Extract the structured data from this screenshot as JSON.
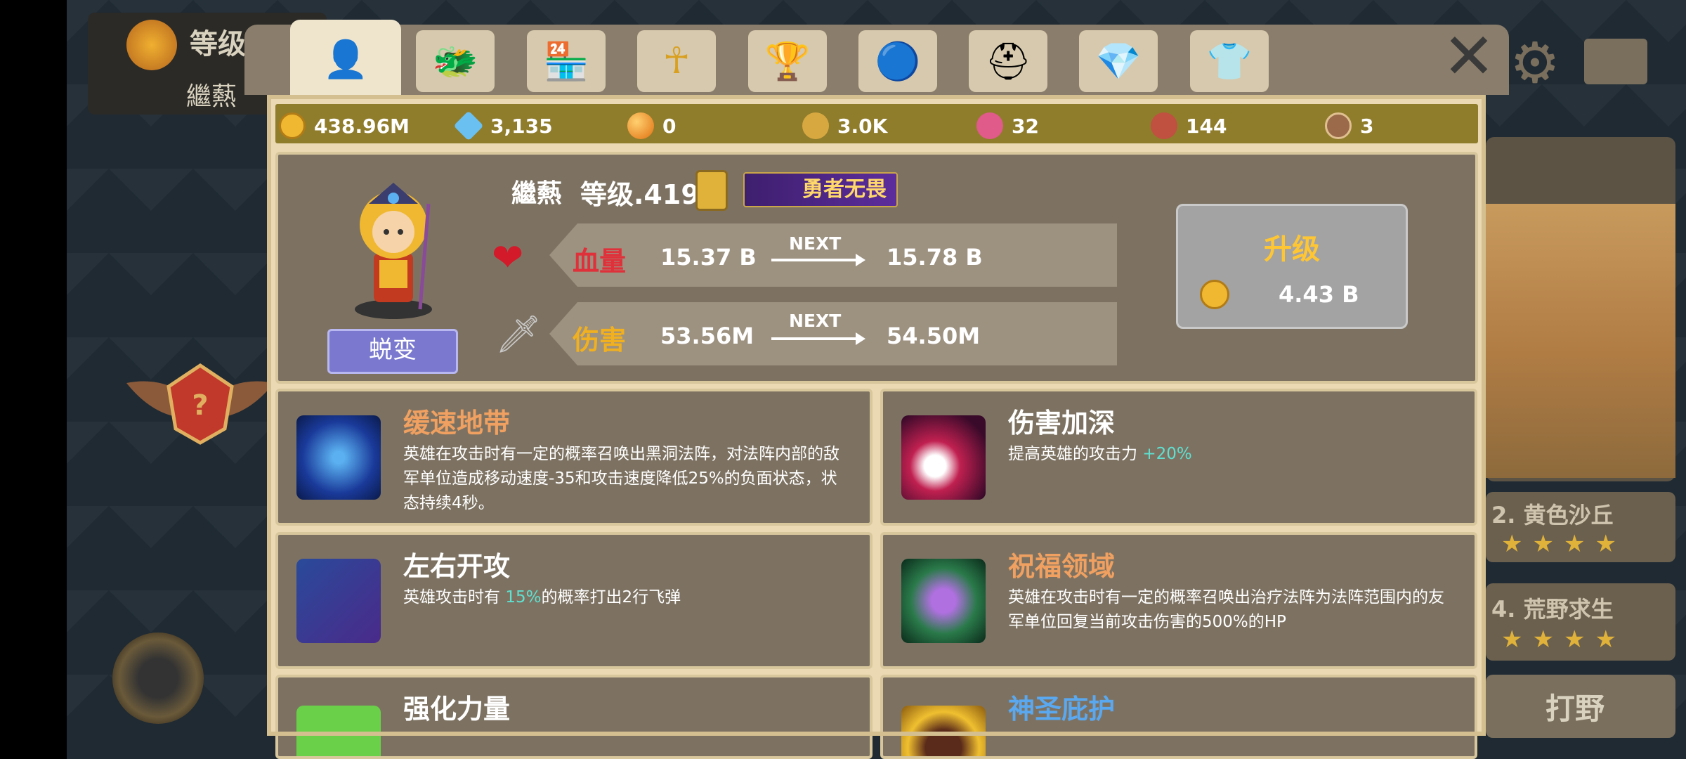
{
  "background": {
    "level_label": "等级",
    "player_name": "繼爇",
    "stage2": "2. 黄色沙丘",
    "stage4": "4. 荒野求生",
    "stars": "★★★★",
    "hunt_button": "打野"
  },
  "tabs": [
    {
      "icon": "person-icon",
      "glyph": "👤"
    },
    {
      "icon": "dragon-icon",
      "glyph": "🐲"
    },
    {
      "icon": "shop-icon",
      "glyph": "🏪"
    },
    {
      "icon": "ankh-icon",
      "glyph": "☥"
    },
    {
      "icon": "trophy-icon",
      "glyph": "🏆"
    },
    {
      "icon": "orb-icon",
      "glyph": "🔵"
    },
    {
      "icon": "helmet-icon",
      "glyph": "⛑"
    },
    {
      "icon": "gem-icon",
      "glyph": "💎"
    },
    {
      "icon": "shirt-icon",
      "glyph": "👕"
    }
  ],
  "resources": {
    "gold": "438.96M",
    "diamond": "3,135",
    "orb": "0",
    "res4": "3.0K",
    "res5": "32",
    "res6": "144",
    "res7": "3"
  },
  "hero": {
    "name": "繼爇",
    "level": "等级.419",
    "title_badge": "勇者无畏",
    "evolve_button": "蜕变",
    "next_label": "NEXT",
    "hp_label": "血量",
    "hp_current": "15.37 B",
    "hp_next": "15.78 B",
    "atk_label": "伤害",
    "atk_current": "53.56M",
    "atk_next": "54.50M",
    "upgrade_label": "升级",
    "upgrade_cost": "4.43 B"
  },
  "skills": [
    {
      "title": "缓速地带",
      "title_color": "#f0a060",
      "desc": "英雄在攻击时有一定的概率召唤出黑洞法阵，对法阵内部的敌军单位造成移动速度-35和攻击速度降低25%的负面状态，状态持续4秒。",
      "desc_pre": "",
      "desc_hl": "",
      "desc_post": ""
    },
    {
      "title": "伤害加深",
      "title_color": "#ffffff",
      "desc_pre": "提高英雄的攻击力 ",
      "desc_hl": "+20%",
      "desc_post": ""
    },
    {
      "title": "左右开攻",
      "title_color": "#ffffff",
      "desc_pre": "英雄攻击时有 ",
      "desc_hl": "15%",
      "desc_post": "的概率打出2行飞弹"
    },
    {
      "title": "祝福领域",
      "title_color": "#f0a060",
      "desc": "英雄在攻击时有一定的概率召唤出治疗法阵为法阵范围内的友军单位回复当前攻击伤害的500%的HP"
    },
    {
      "title": "强化力量",
      "title_color": "#ffffff"
    },
    {
      "title": "神圣庇护",
      "title_color": "#5aa8f0"
    }
  ],
  "colors": {
    "panel_bg": "#7d7262",
    "frame": "#d8c79d",
    "gold_text": "#ffc634",
    "hp_red": "#e0303a",
    "atk_gold": "#f0b020",
    "highlight": "#5fe0d0"
  }
}
